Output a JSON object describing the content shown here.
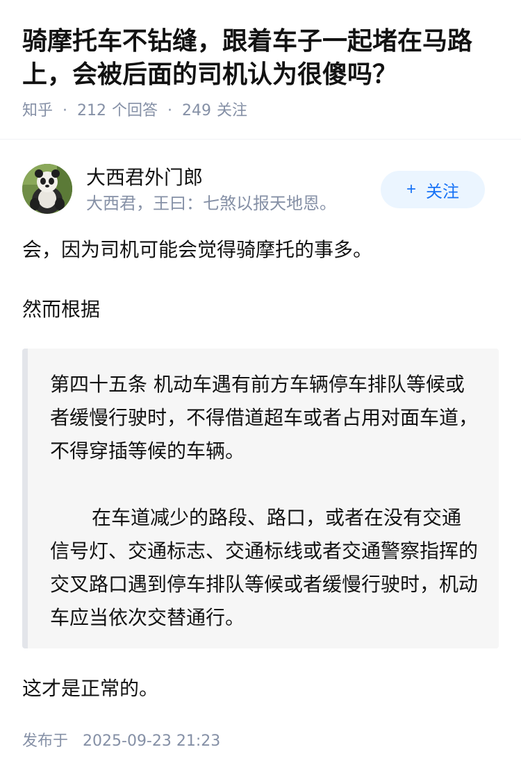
{
  "question": {
    "title": "骑摩托车不钻缝，跟着车子一起堵在马路上，会被后面的司机认为很傻吗？",
    "source": "知乎",
    "answers_count": "212",
    "answers_label": "个回答",
    "followers_count": "249",
    "followers_label": "关注"
  },
  "author": {
    "name": "大西君外门郎",
    "bio": "大西君，王曰：七煞以报天地恩。",
    "follow_button": "关注",
    "follow_icon": "+"
  },
  "answer": {
    "paragraph1": "会，因为司机可能会觉得骑摩托的事多。",
    "paragraph2": "然而根据",
    "quote_paragraph1": "第四十五条 机动车遇有前方车辆停车排队等候或者缓慢行驶时，不得借道超车或者占用对面车道，不得穿插等候的车辆。",
    "quote_paragraph2": "在车道减少的路段、路口，或者在没有交通信号灯、交通标志、交通标线或者交通警察指挥的交叉路口遇到停车排队等候或者缓慢行驶时，机动车应当依次交替通行。",
    "paragraph3": "这才是正常的。",
    "published_label": "发布于",
    "published_time": "2025-09-23 21:23"
  },
  "colors": {
    "accent": "#1772f6",
    "follow_bg": "#ebf5ff",
    "meta_text": "#8590a6",
    "quote_bg": "#f6f6f6",
    "quote_bar": "#e3e5ea"
  }
}
